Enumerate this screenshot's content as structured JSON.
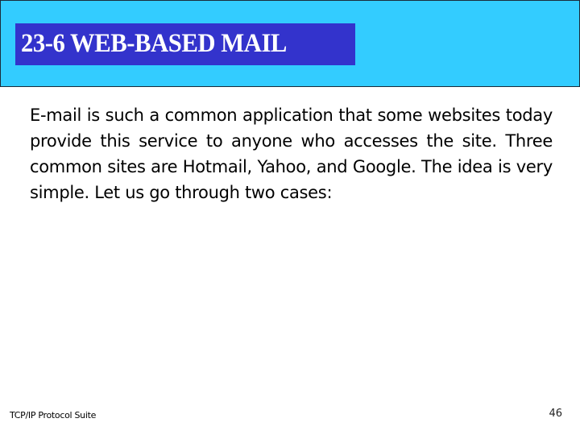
{
  "slide": {
    "title": "23-6  WEB-BASED MAIL",
    "body": "E-mail is such a common application that some websites today provide this service to anyone who accesses the site. Three common sites are Hotmail, Yahoo, and Google. The idea is very simple. Let us go through two cases:",
    "footer_left": "TCP/IP Protocol Suite",
    "page_number": "46"
  },
  "colors": {
    "header_band": "#33ccff",
    "title_box": "#3333cc",
    "title_text": "#ffffff"
  }
}
